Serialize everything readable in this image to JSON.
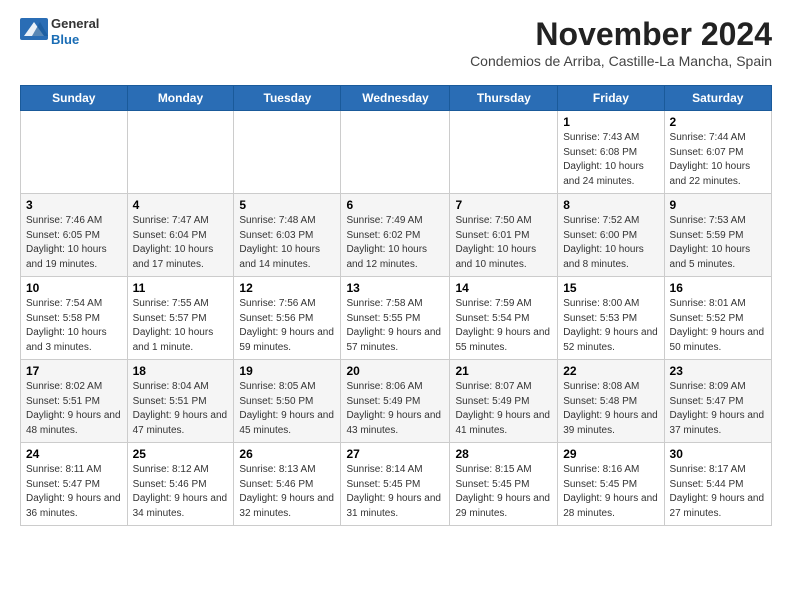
{
  "logo": {
    "line1": "General",
    "line2": "Blue"
  },
  "header": {
    "month": "November 2024",
    "location": "Condemios de Arriba, Castille-La Mancha, Spain"
  },
  "weekdays": [
    "Sunday",
    "Monday",
    "Tuesday",
    "Wednesday",
    "Thursday",
    "Friday",
    "Saturday"
  ],
  "weeks": [
    [
      {
        "day": "",
        "info": ""
      },
      {
        "day": "",
        "info": ""
      },
      {
        "day": "",
        "info": ""
      },
      {
        "day": "",
        "info": ""
      },
      {
        "day": "",
        "info": ""
      },
      {
        "day": "1",
        "info": "Sunrise: 7:43 AM\nSunset: 6:08 PM\nDaylight: 10 hours and 24 minutes."
      },
      {
        "day": "2",
        "info": "Sunrise: 7:44 AM\nSunset: 6:07 PM\nDaylight: 10 hours and 22 minutes."
      }
    ],
    [
      {
        "day": "3",
        "info": "Sunrise: 7:46 AM\nSunset: 6:05 PM\nDaylight: 10 hours and 19 minutes."
      },
      {
        "day": "4",
        "info": "Sunrise: 7:47 AM\nSunset: 6:04 PM\nDaylight: 10 hours and 17 minutes."
      },
      {
        "day": "5",
        "info": "Sunrise: 7:48 AM\nSunset: 6:03 PM\nDaylight: 10 hours and 14 minutes."
      },
      {
        "day": "6",
        "info": "Sunrise: 7:49 AM\nSunset: 6:02 PM\nDaylight: 10 hours and 12 minutes."
      },
      {
        "day": "7",
        "info": "Sunrise: 7:50 AM\nSunset: 6:01 PM\nDaylight: 10 hours and 10 minutes."
      },
      {
        "day": "8",
        "info": "Sunrise: 7:52 AM\nSunset: 6:00 PM\nDaylight: 10 hours and 8 minutes."
      },
      {
        "day": "9",
        "info": "Sunrise: 7:53 AM\nSunset: 5:59 PM\nDaylight: 10 hours and 5 minutes."
      }
    ],
    [
      {
        "day": "10",
        "info": "Sunrise: 7:54 AM\nSunset: 5:58 PM\nDaylight: 10 hours and 3 minutes."
      },
      {
        "day": "11",
        "info": "Sunrise: 7:55 AM\nSunset: 5:57 PM\nDaylight: 10 hours and 1 minute."
      },
      {
        "day": "12",
        "info": "Sunrise: 7:56 AM\nSunset: 5:56 PM\nDaylight: 9 hours and 59 minutes."
      },
      {
        "day": "13",
        "info": "Sunrise: 7:58 AM\nSunset: 5:55 PM\nDaylight: 9 hours and 57 minutes."
      },
      {
        "day": "14",
        "info": "Sunrise: 7:59 AM\nSunset: 5:54 PM\nDaylight: 9 hours and 55 minutes."
      },
      {
        "day": "15",
        "info": "Sunrise: 8:00 AM\nSunset: 5:53 PM\nDaylight: 9 hours and 52 minutes."
      },
      {
        "day": "16",
        "info": "Sunrise: 8:01 AM\nSunset: 5:52 PM\nDaylight: 9 hours and 50 minutes."
      }
    ],
    [
      {
        "day": "17",
        "info": "Sunrise: 8:02 AM\nSunset: 5:51 PM\nDaylight: 9 hours and 48 minutes."
      },
      {
        "day": "18",
        "info": "Sunrise: 8:04 AM\nSunset: 5:51 PM\nDaylight: 9 hours and 47 minutes."
      },
      {
        "day": "19",
        "info": "Sunrise: 8:05 AM\nSunset: 5:50 PM\nDaylight: 9 hours and 45 minutes."
      },
      {
        "day": "20",
        "info": "Sunrise: 8:06 AM\nSunset: 5:49 PM\nDaylight: 9 hours and 43 minutes."
      },
      {
        "day": "21",
        "info": "Sunrise: 8:07 AM\nSunset: 5:49 PM\nDaylight: 9 hours and 41 minutes."
      },
      {
        "day": "22",
        "info": "Sunrise: 8:08 AM\nSunset: 5:48 PM\nDaylight: 9 hours and 39 minutes."
      },
      {
        "day": "23",
        "info": "Sunrise: 8:09 AM\nSunset: 5:47 PM\nDaylight: 9 hours and 37 minutes."
      }
    ],
    [
      {
        "day": "24",
        "info": "Sunrise: 8:11 AM\nSunset: 5:47 PM\nDaylight: 9 hours and 36 minutes."
      },
      {
        "day": "25",
        "info": "Sunrise: 8:12 AM\nSunset: 5:46 PM\nDaylight: 9 hours and 34 minutes."
      },
      {
        "day": "26",
        "info": "Sunrise: 8:13 AM\nSunset: 5:46 PM\nDaylight: 9 hours and 32 minutes."
      },
      {
        "day": "27",
        "info": "Sunrise: 8:14 AM\nSunset: 5:45 PM\nDaylight: 9 hours and 31 minutes."
      },
      {
        "day": "28",
        "info": "Sunrise: 8:15 AM\nSunset: 5:45 PM\nDaylight: 9 hours and 29 minutes."
      },
      {
        "day": "29",
        "info": "Sunrise: 8:16 AM\nSunset: 5:45 PM\nDaylight: 9 hours and 28 minutes."
      },
      {
        "day": "30",
        "info": "Sunrise: 8:17 AM\nSunset: 5:44 PM\nDaylight: 9 hours and 27 minutes."
      }
    ]
  ]
}
